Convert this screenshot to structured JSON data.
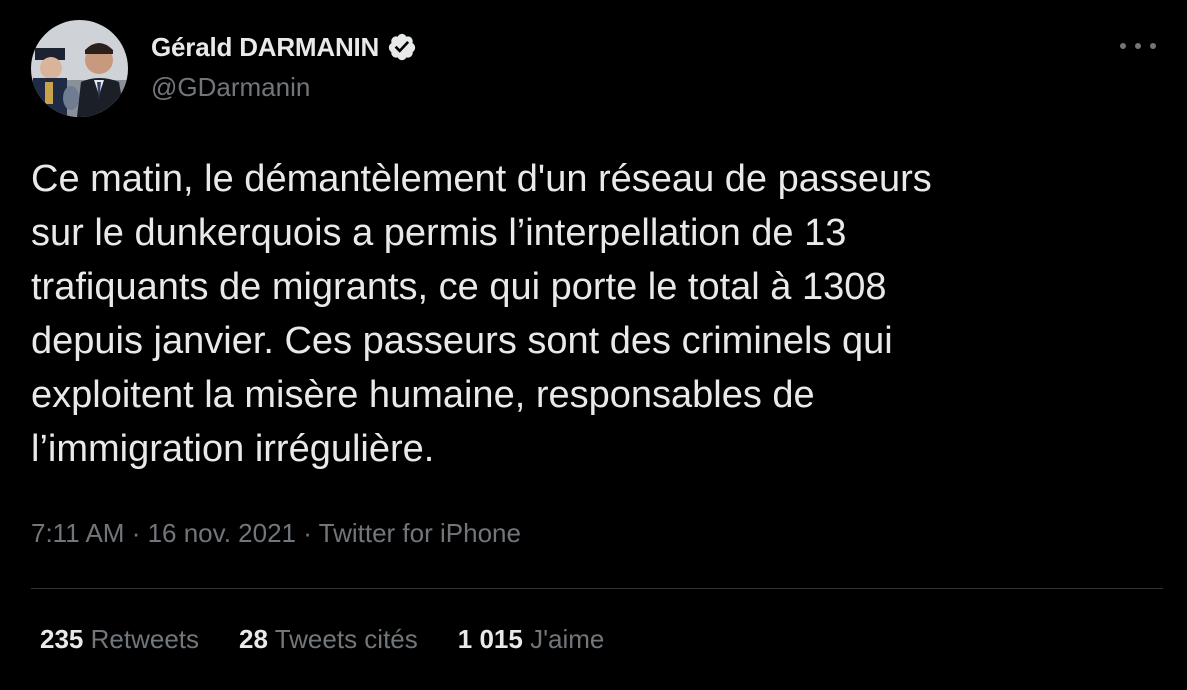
{
  "author": {
    "display_name": "Gérald DARMANIN",
    "handle": "@GDarmanin",
    "verified": true,
    "verified_icon": "verified-badge-icon"
  },
  "tweet": {
    "text": "Ce matin, le démantèlement d'un réseau de passeurs\nsur le dunkerquois a permis l’interpellation de 13\ntrafiquants de migrants, ce qui porte le total à 1308\ndepuis janvier. Ces passeurs sont des criminels qui\nexploitent la misère humaine, responsables de\nl’immigration irrégulière.",
    "time": "7:11 AM",
    "separator": " · ",
    "date": "16 nov. 2021",
    "source": "Twitter for iPhone"
  },
  "stats": {
    "retweets_count": "235",
    "retweets_label": "Retweets",
    "quotes_count": "28",
    "quotes_label": "Tweets cités",
    "likes_count": "1 015",
    "likes_label": "J'aime"
  },
  "colors": {
    "background": "#000000",
    "text_primary": "#e7e9ea",
    "text_secondary": "#71767b",
    "divider": "#2f3336"
  }
}
